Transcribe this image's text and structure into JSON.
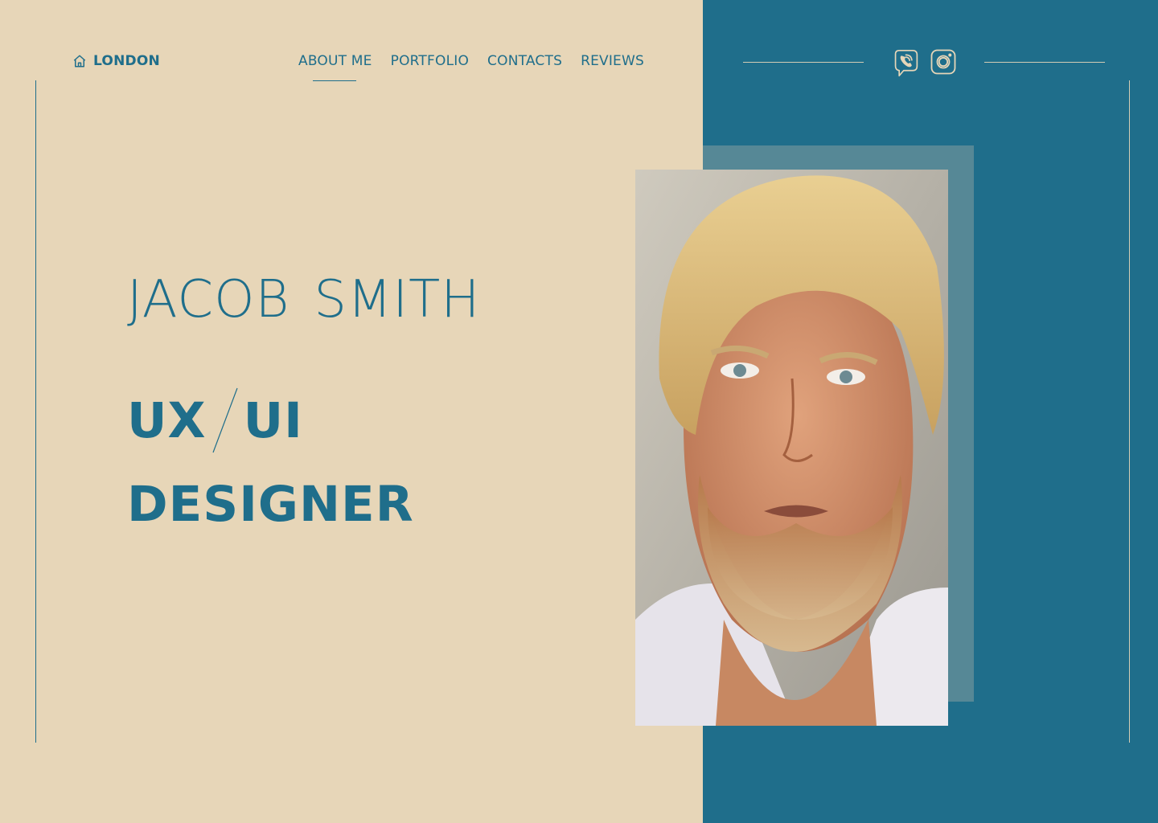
{
  "location": {
    "label": "LONDON",
    "icon": "home-icon"
  },
  "nav": {
    "items": [
      {
        "label": "ABOUT ME",
        "active": true
      },
      {
        "label": "PORTFOLIO",
        "active": false
      },
      {
        "label": "CONTACTS",
        "active": false
      },
      {
        "label": "REVIEWS",
        "active": false
      }
    ]
  },
  "social": [
    {
      "name": "viber-icon"
    },
    {
      "name": "instagram-icon"
    }
  ],
  "hero": {
    "first_name": "JACOB",
    "last_name": "SMITH",
    "role_part1": "UX",
    "role_part2": "UI",
    "role_line2": "DESIGNER"
  },
  "colors": {
    "beige": "#e7d6b8",
    "teal": "#1f6e8b",
    "muted_teal": "#568896"
  }
}
